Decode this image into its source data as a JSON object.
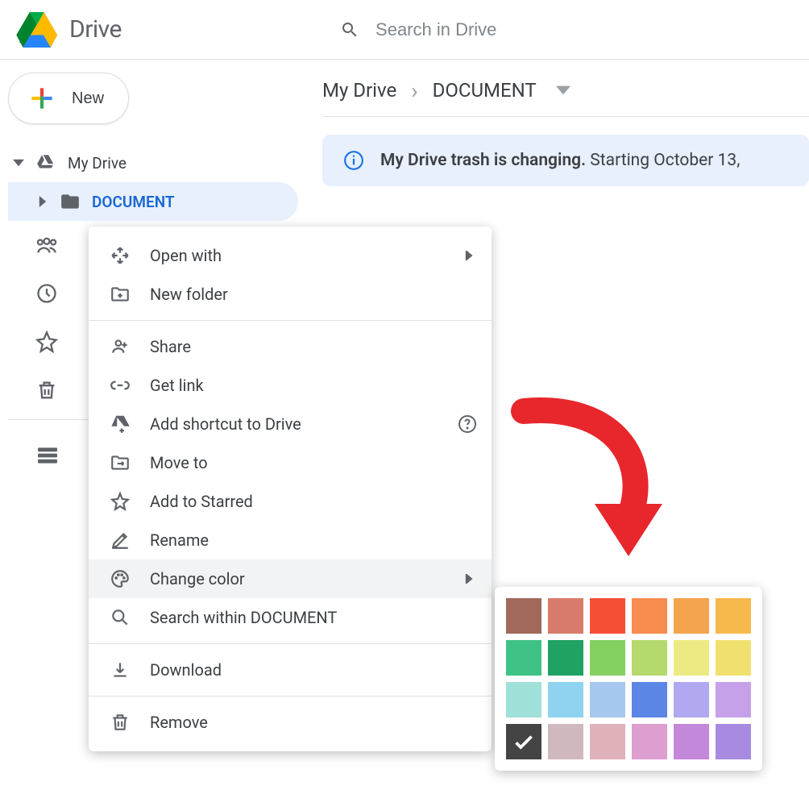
{
  "header": {
    "product_name": "Drive",
    "search_placeholder": "Search in Drive"
  },
  "sidebar": {
    "new_label": "New",
    "my_drive_label": "My Drive",
    "selected_folder": "DOCUMENT"
  },
  "breadcrumb": {
    "root": "My Drive",
    "current": "DOCUMENT"
  },
  "banner": {
    "bold": "My Drive trash is changing.",
    "rest": " Starting October 13,"
  },
  "context_menu": {
    "open_with": "Open with",
    "new_folder": "New folder",
    "share": "Share",
    "get_link": "Get link",
    "add_shortcut": "Add shortcut to Drive",
    "move_to": "Move to",
    "add_to_starred": "Add to Starred",
    "rename": "Rename",
    "change_color": "Change color",
    "search_within": "Search within DOCUMENT",
    "download": "Download",
    "remove": "Remove"
  },
  "palette": {
    "colors": [
      "#a0695a",
      "#d97b6c",
      "#f74e36",
      "#f88b4e",
      "#f5a44e",
      "#f7b84e",
      "#3fc285",
      "#20a264",
      "#84d162",
      "#b6d96d",
      "#ecea82",
      "#f0e070",
      "#9fe0d8",
      "#8fd3f0",
      "#a6c8ef",
      "#5b86e5",
      "#b0a8f0",
      "#c6a1ea",
      "#444444",
      "#d0b8bf",
      "#e0b1b8",
      "#dd9fd0",
      "#c488db",
      "#a88be0"
    ],
    "selected_index": 18
  }
}
